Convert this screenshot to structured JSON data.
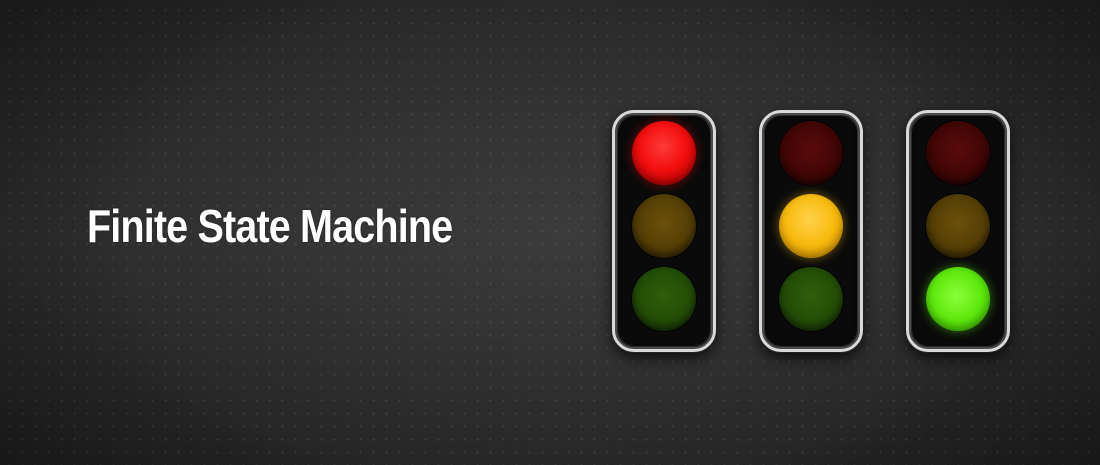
{
  "banner": {
    "title": "Finite State Machine"
  },
  "traffic_lights": [
    {
      "active_lamp": "red"
    },
    {
      "active_lamp": "amber"
    },
    {
      "active_lamp": "green"
    }
  ],
  "colors": {
    "background": "#2a2a2a",
    "title_text": "#ffffff",
    "red_on": "#f21010",
    "amber_on": "#f7b90e",
    "green_on": "#5fe80e",
    "housing": "#0a0a0a",
    "housing_rim": "#d9d9d9"
  }
}
